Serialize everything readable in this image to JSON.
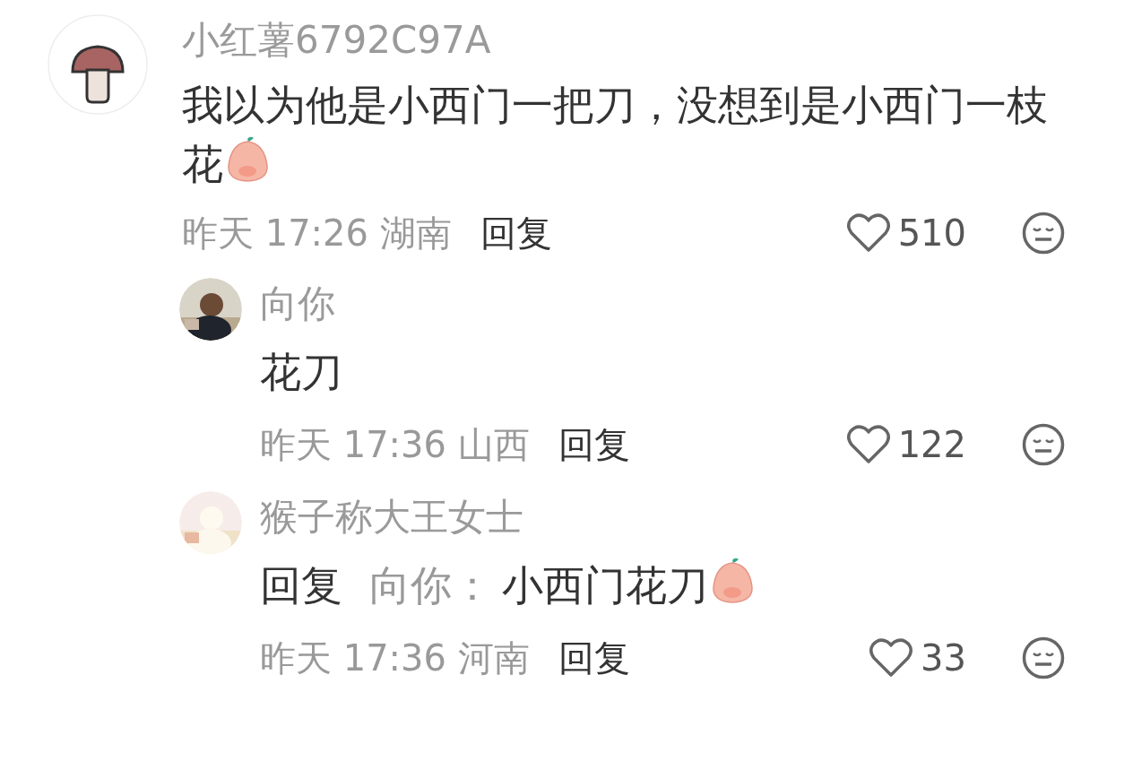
{
  "comments": [
    {
      "author": "小红薯6792C97A",
      "avatar": {
        "kind": "mushroom"
      },
      "content": [
        {
          "kind": "text",
          "text": "我以为他是小西门一把刀，没想到是小西门一枝花"
        },
        {
          "kind": "sticker"
        }
      ],
      "time": "昨天 17:26 湖南",
      "reply_button": "回复",
      "likes": "510",
      "liked": false,
      "replies": [
        {
          "author": "向你",
          "avatar": {
            "kind": "picture"
          },
          "content": [
            {
              "kind": "text",
              "text": "花刀"
            }
          ],
          "time": "昨天 17:36 山西",
          "reply_button": "回复",
          "likes": "122",
          "liked": false
        },
        {
          "author": "猴子称大王女士",
          "avatar": {
            "kind": "picture"
          },
          "content": [
            {
              "kind": "label",
              "text": "回复"
            },
            {
              "kind": "mention",
              "text": "向你："
            },
            {
              "kind": "text",
              "text": "小西门花刀"
            },
            {
              "kind": "sticker"
            }
          ],
          "time": "昨天 17:36 河南",
          "reply_button": "回复",
          "likes": "33",
          "liked": false
        }
      ]
    }
  ]
}
